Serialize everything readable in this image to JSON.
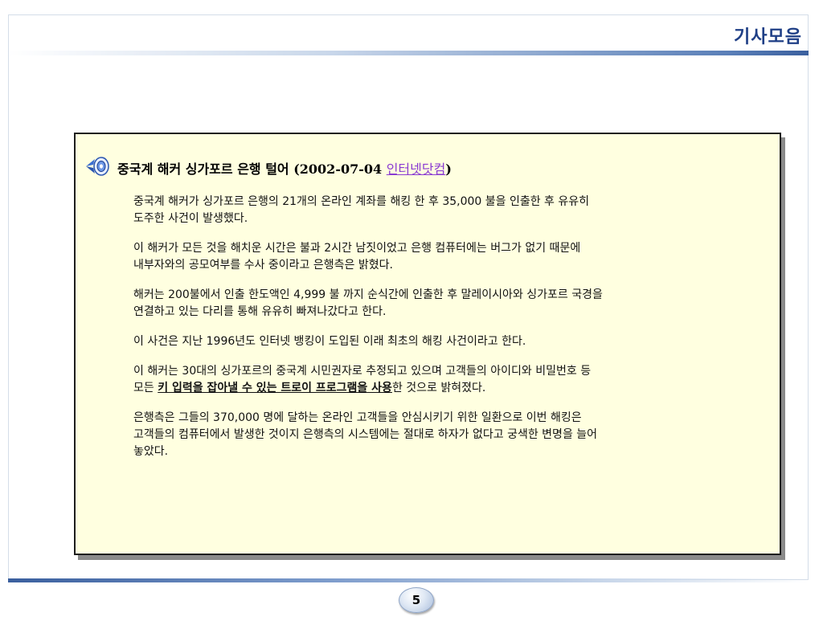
{
  "header": {
    "title": "기사모음"
  },
  "article": {
    "title_prefix": "중국계 해커 싱가포르 은행 털어 (2002-07-04 ",
    "source_link": "인터넷닷컴",
    "title_suffix": ")",
    "paragraphs": [
      {
        "lines": [
          "중국계 해커가 싱가포르 은행의 21개의 온라인 계좌를 해킹 한 후 35,000 불을 인출한 후 유유히",
          "도주한 사건이 발생했다."
        ]
      },
      {
        "lines": [
          "이 해커가 모든 것을 해치운 시간은 불과 2시간 남짓이었고 은행 컴퓨터에는 버그가 없기 때문에",
          "내부자와의 공모여부를 수사 중이라고 은행측은 밝혔다."
        ]
      },
      {
        "lines": [
          "해커는 200불에서 인출 한도액인 4,999 불 까지 순식간에 인출한 후 말레이시아와 싱가포르 국경을",
          "연결하고 있는 다리를 통해 유유히 빠져나갔다고 한다."
        ]
      },
      {
        "lines": [
          "이 사건은 지난 1996년도 인터넷 뱅킹이 도입된 이래 최초의 해킹 사건이라고 한다."
        ]
      },
      {
        "line1": "이 해커는 30대의 싱가포르의 중국계 시민권자로 추정되고 있으며 고객들의 아이디와 비밀번호 등",
        "line2_prefix": "모든 ",
        "line2_highlight": "키 입력을 잡아낼 수 있는 트로이 프로그램을 사용",
        "line2_suffix": "한 것으로 밝혀졌다."
      },
      {
        "lines": [
          "은행측은 그들의 370,000 명에 달하는 온라인 고객들을 안심시키기 위한 일환으로 이번 해킹은",
          "고객들의 컴퓨터에서 발생한 것이지 은행측의 시스템에는 절대로 하자가 없다고 궁색한 변명을 늘어",
          "놓았다."
        ]
      }
    ]
  },
  "footer": {
    "page_number": "5"
  },
  "colors": {
    "header_title": "#1f3f86",
    "panel_background": "#ffffe0",
    "link": "#8a3bd1"
  }
}
